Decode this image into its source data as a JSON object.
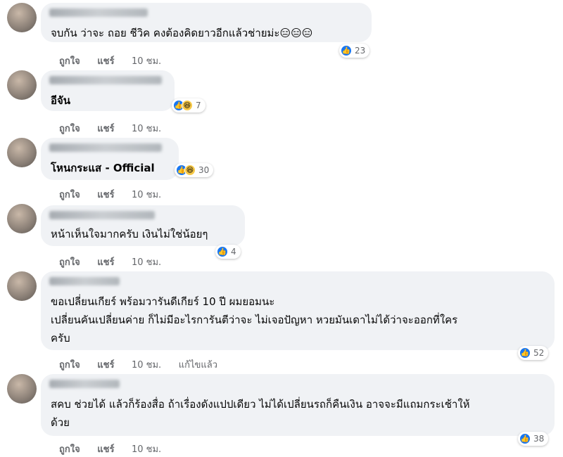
{
  "comments": [
    {
      "text": [
        "จบกัน ว่าจะ ถอย ชีวิค คงต้องคิดยาวอีกแล้วช่ายม่ะ😑😑😑"
      ],
      "reactions": 23,
      "like": "ถูกใจ",
      "share": "แชร์",
      "time": "10 ชม."
    },
    {
      "text": [
        "อีจัน"
      ],
      "reactions": 7,
      "like": "ถูกใจ",
      "share": "แชร์",
      "time": "10 ชม."
    },
    {
      "text": [
        "โหนกระแส - Official"
      ],
      "reactions": 30,
      "like": "ถูกใจ",
      "share": "แชร์",
      "time": "10 ชม."
    },
    {
      "text": [
        "หน้าเห็นใจมากครับ เงินไม่ใช่น้อยๆ"
      ],
      "reactions": 4,
      "like": "ถูกใจ",
      "share": "แชร์",
      "time": "10 ชม."
    },
    {
      "text": [
        "ขอเปลี่ยนเกียร์ พร้อมวารันดีเกียร์ 10 ปี ผมยอมนะ",
        "เปลี่ยนคันเปลี่ยนค่าย ก็ไม่มีอะไรการันตีว่าจะ ไม่เจอปัญหา หวยมันเดาไม่ได้ว่าจะออกที่ใคร",
        "ครับ"
      ],
      "reactions": 52,
      "like": "ถูกใจ",
      "share": "แชร์",
      "time": "10 ชม.",
      "edited": "แก้ไขแล้ว"
    },
    {
      "text": [
        "สคบ ช่วยได้ แล้วก็ร้องสื่อ ถ้าเรื่องดังแปปเดียว ไม่ได้เปลี่ยนรถก็คืนเงิน อาจจะมีแถมกระเช้าให้",
        "ด้วย"
      ],
      "reactions": 38,
      "like": "ถูกใจ",
      "share": "แชร์",
      "time": "10 ชม."
    }
  ],
  "icons": {
    "like": "thumbs-up-icon",
    "haha": "haha-emoji-icon"
  },
  "colors": {
    "bubble": "#f0f2f5",
    "like_blue": "#1877f2",
    "meta_gray": "#65676b"
  }
}
